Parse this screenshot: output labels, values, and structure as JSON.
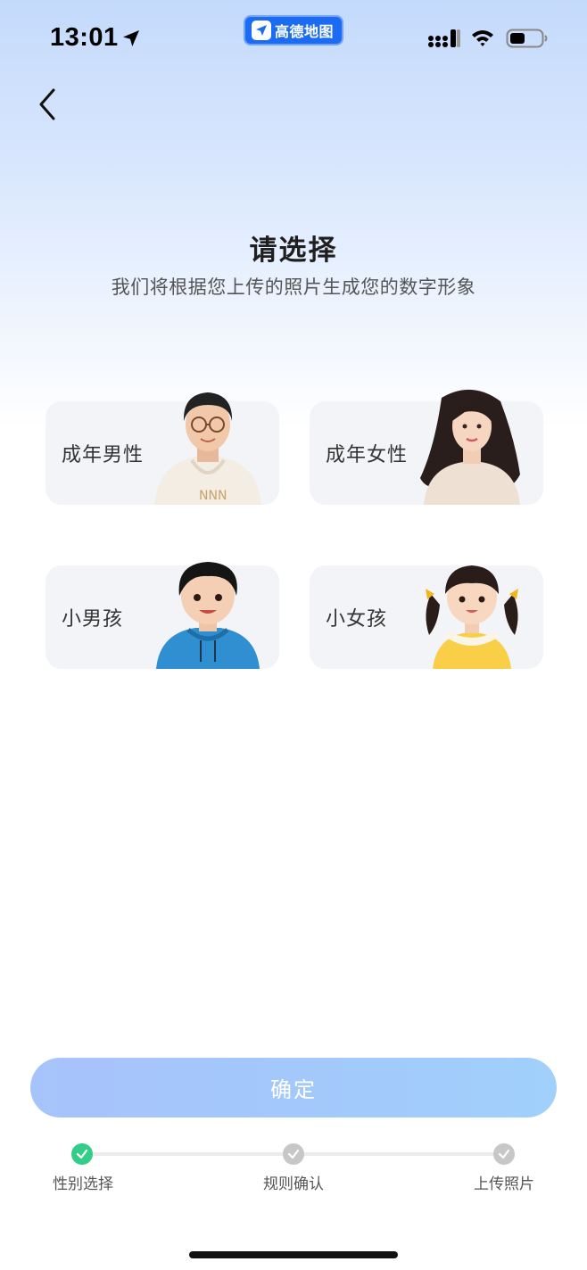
{
  "status_bar": {
    "time": "13:01",
    "app_pill_label": "高德地图"
  },
  "header": {
    "title": "请选择",
    "subtitle": "我们将根据您上传的照片生成您的数字形象"
  },
  "options": [
    {
      "label": "成年男性",
      "icon": "adult-male-avatar"
    },
    {
      "label": "成年女性",
      "icon": "adult-female-avatar"
    },
    {
      "label": "小男孩",
      "icon": "boy-avatar"
    },
    {
      "label": "小女孩",
      "icon": "girl-avatar"
    }
  ],
  "confirm_label": "确定",
  "steps": [
    {
      "label": "性别选择",
      "status": "done"
    },
    {
      "label": "规则确认",
      "status": "pending"
    },
    {
      "label": "上传照片",
      "status": "pending"
    }
  ],
  "colors": {
    "accent_green": "#33cc88",
    "button_gradient_start": "#a7c3fb",
    "button_gradient_end": "#a1d0fb",
    "app_pill": "#1b6cf2"
  }
}
